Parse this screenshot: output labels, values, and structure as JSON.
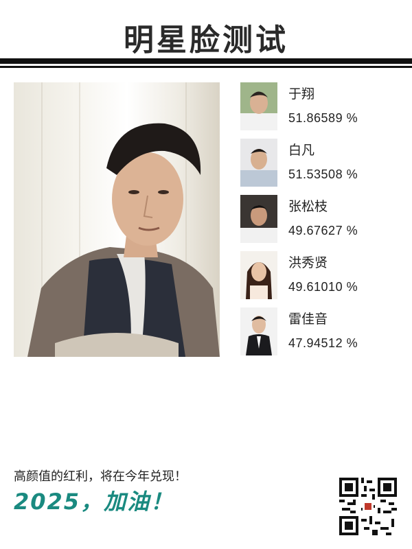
{
  "header": {
    "title": "明星脸测试"
  },
  "matches": [
    {
      "name": "于翔",
      "score": "51.86589 %"
    },
    {
      "name": "白凡",
      "score": "51.53508 %"
    },
    {
      "name": "张松枝",
      "score": "49.67627 %"
    },
    {
      "name": "洪秀贤",
      "score": "49.61010 %"
    },
    {
      "name": "雷佳音",
      "score": "47.94512 %"
    }
  ],
  "footer": {
    "slogan_line1": "高颜值的红利，将在今年兑现！",
    "slogan_line2": "2025，加油！"
  },
  "colors": {
    "accent": "#1a8a80",
    "rule": "#111111"
  }
}
